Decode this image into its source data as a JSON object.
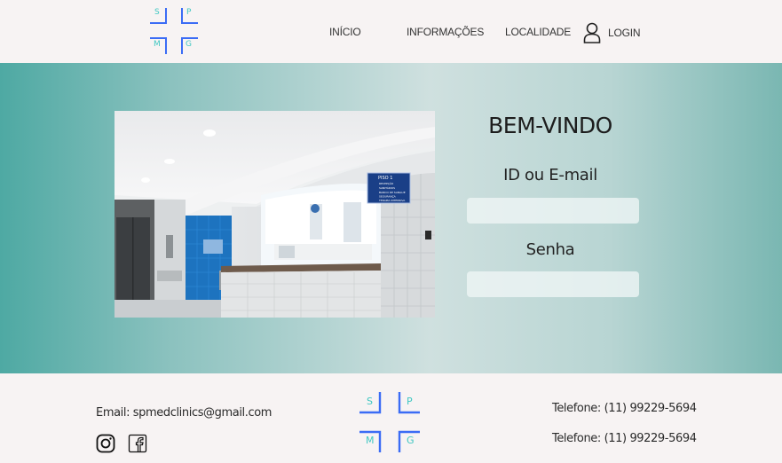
{
  "header": {
    "logo_letters": [
      "S",
      "P",
      "M",
      "G"
    ],
    "nav": [
      {
        "label": "INÍCIO"
      },
      {
        "label": "INFORMAÇÕES"
      },
      {
        "label": "LOCALIDADE"
      }
    ],
    "login_label": "LOGIN",
    "login_icon": "user-icon"
  },
  "hero": {
    "welcome": "BEM-VINDO",
    "id_label": "ID ou E-mail",
    "id_value": "",
    "password_label": "Senha",
    "password_value": "",
    "sign": {
      "title": "PISO 1",
      "lines": [
        "RECEPÇÃO",
        "SANITÁRIOS",
        "BANCO DE SANGUE",
        "SEGURANÇA",
        "TERAPIA INTENSIVA"
      ]
    }
  },
  "footer": {
    "email": "Email: spmedclinics@gmail.com",
    "phones": [
      "Telefone: (11) 99229-5694",
      "Telefone: (11) 99229-5694"
    ],
    "logo_letters": [
      "S",
      "P",
      "M",
      "G"
    ],
    "social_icons": [
      "instagram-icon",
      "facebook-icon"
    ]
  },
  "colors": {
    "logo_blue": "#3b6cf5",
    "logo_teal": "#3fc7c2",
    "hero_teal": "#4ea9a3"
  }
}
